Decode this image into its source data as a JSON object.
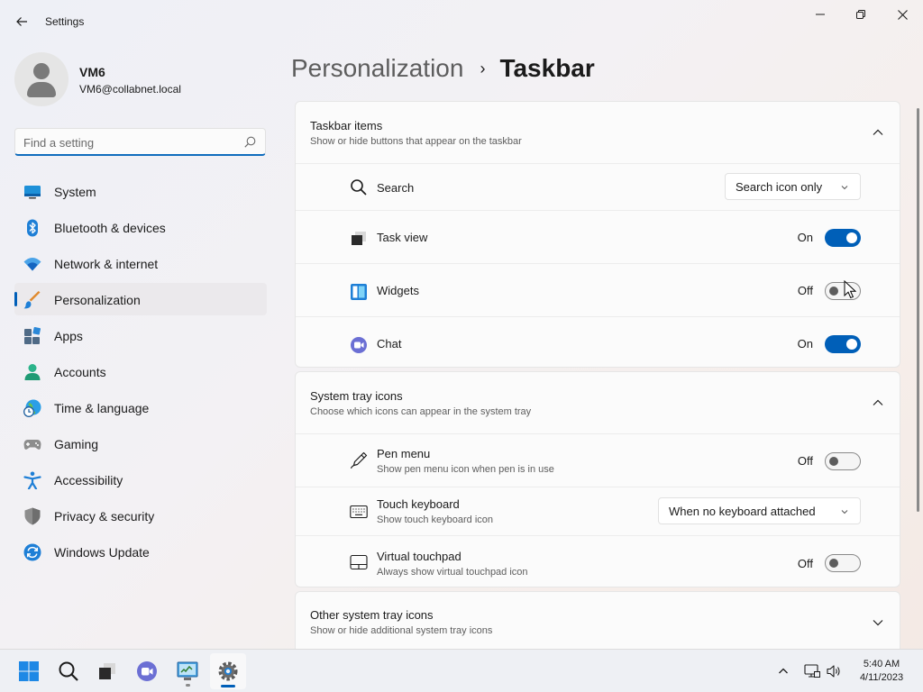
{
  "window": {
    "title": "Settings"
  },
  "profile": {
    "name": "VM6",
    "email": "VM6@collabnet.local"
  },
  "search": {
    "placeholder": "Find a setting",
    "value": ""
  },
  "sidebar": {
    "items": [
      {
        "label": "System",
        "icon": "system-icon",
        "selected": false
      },
      {
        "label": "Bluetooth & devices",
        "icon": "bluetooth-icon",
        "selected": false
      },
      {
        "label": "Network & internet",
        "icon": "network-icon",
        "selected": false
      },
      {
        "label": "Personalization",
        "icon": "personalization-icon",
        "selected": true
      },
      {
        "label": "Apps",
        "icon": "apps-icon",
        "selected": false
      },
      {
        "label": "Accounts",
        "icon": "accounts-icon",
        "selected": false
      },
      {
        "label": "Time & language",
        "icon": "time-language-icon",
        "selected": false
      },
      {
        "label": "Gaming",
        "icon": "gaming-icon",
        "selected": false
      },
      {
        "label": "Accessibility",
        "icon": "accessibility-icon",
        "selected": false
      },
      {
        "label": "Privacy & security",
        "icon": "privacy-icon",
        "selected": false
      },
      {
        "label": "Windows Update",
        "icon": "windows-update-icon",
        "selected": false
      }
    ]
  },
  "breadcrumb": {
    "parent": "Personalization",
    "separator": "›",
    "current": "Taskbar"
  },
  "taskbar_items": {
    "title": "Taskbar items",
    "subtitle": "Show or hide buttons that appear on the taskbar",
    "expanded": true,
    "rows": {
      "search": {
        "label": "Search",
        "value": "Search icon only"
      },
      "task_view": {
        "label": "Task view",
        "state": "On",
        "on": true
      },
      "widgets": {
        "label": "Widgets",
        "state": "Off",
        "on": false
      },
      "chat": {
        "label": "Chat",
        "state": "On",
        "on": true
      }
    }
  },
  "system_tray": {
    "title": "System tray icons",
    "subtitle": "Choose which icons can appear in the system tray",
    "expanded": true,
    "rows": {
      "pen_menu": {
        "label": "Pen menu",
        "sub": "Show pen menu icon when pen is in use",
        "state": "Off",
        "on": false
      },
      "touch_keyboard": {
        "label": "Touch keyboard",
        "sub": "Show touch keyboard icon",
        "value": "When no keyboard attached"
      },
      "virtual_touchpad": {
        "label": "Virtual touchpad",
        "sub": "Always show virtual touchpad icon",
        "state": "Off",
        "on": false
      }
    }
  },
  "other_tray": {
    "title": "Other system tray icons",
    "subtitle": "Show or hide additional system tray icons",
    "expanded": false
  },
  "taskbar": {
    "apps": [
      "start-icon",
      "search-icon",
      "task-view-icon",
      "chat-icon",
      "control-panel-icon",
      "settings-icon"
    ],
    "clock": {
      "time": "5:40 AM",
      "date": "4/11/2023"
    }
  },
  "colors": {
    "accent": "#005fb8",
    "selected_bg": "#ebe9ec",
    "card_bg": "#fbfbfb"
  }
}
